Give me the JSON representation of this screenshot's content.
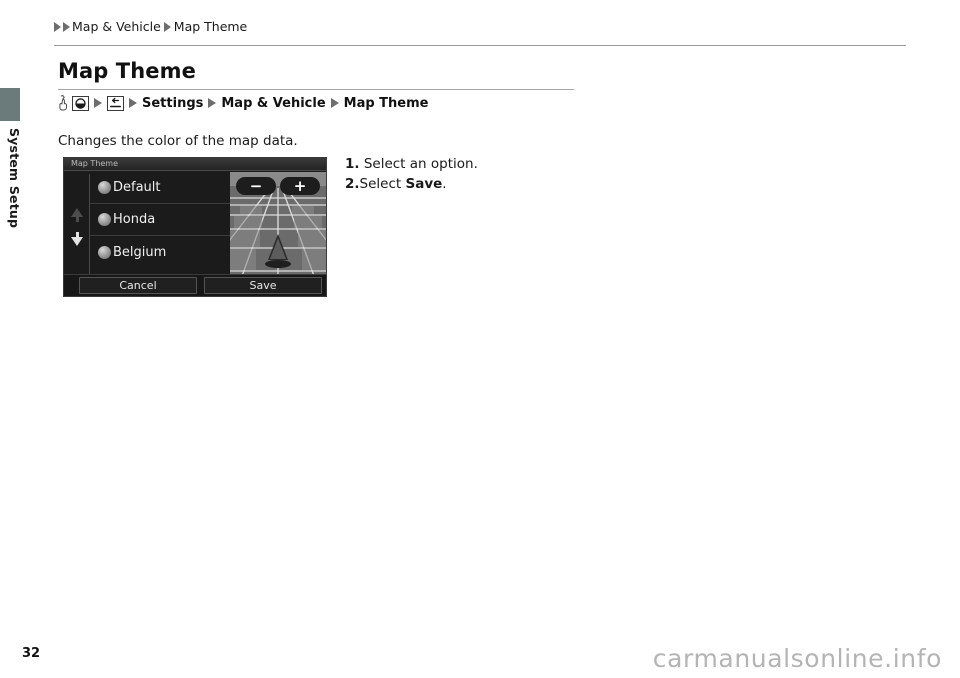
{
  "sidebar": {
    "tab_color": "#6b7b7b",
    "section_label": "System Setup"
  },
  "header": {
    "breadcrumb": [
      "Map & Vehicle",
      "Map Theme"
    ]
  },
  "page": {
    "title": "Map Theme",
    "description": "Changes the color of the map data.",
    "number": "32"
  },
  "nav_path": {
    "icons": [
      "finger-press-icon",
      "nav-home-icon",
      "back-arrow-icon"
    ],
    "items": [
      "Settings",
      "Map & Vehicle",
      "Map Theme"
    ]
  },
  "steps": [
    {
      "num": "1.",
      "text": "Select an option.",
      "bold_word": ""
    },
    {
      "num": "2.",
      "pre": "Select ",
      "bold_word": "Save",
      "post": "."
    }
  ],
  "device": {
    "titlebar": "Map Theme",
    "options": [
      {
        "label": "Default",
        "selected": false
      },
      {
        "label": "Honda",
        "selected": false
      },
      {
        "label": "Belgium",
        "selected": false
      }
    ],
    "scroll": {
      "up_icon": "arrow-up-icon",
      "down_icon": "arrow-down-icon"
    },
    "map_preview": {
      "zoom_out_label": "−",
      "zoom_in_label": "+",
      "vehicle_marker": "vehicle-arrow-icon"
    },
    "buttons": {
      "cancel": "Cancel",
      "save": "Save"
    }
  },
  "footer": {
    "watermark": "carmanualsonline.info"
  }
}
